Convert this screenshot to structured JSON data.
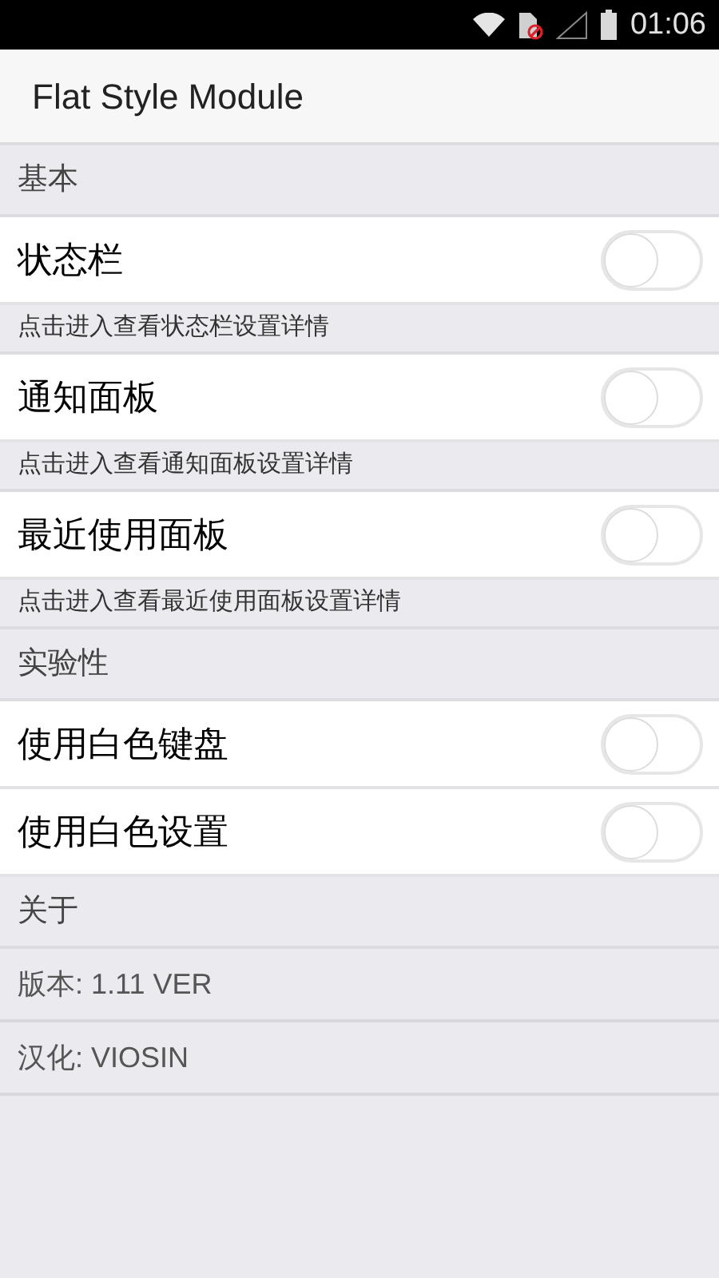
{
  "status_bar": {
    "time": "01:06"
  },
  "app_bar": {
    "title": "Flat Style Module"
  },
  "sections": [
    {
      "header": "基本",
      "items": [
        {
          "kind": "toggle",
          "label": "状态栏",
          "on": false
        },
        {
          "kind": "hint",
          "text": "点击进入查看状态栏设置详情"
        },
        {
          "kind": "toggle",
          "label": "通知面板",
          "on": false
        },
        {
          "kind": "hint",
          "text": "点击进入查看通知面板设置详情"
        },
        {
          "kind": "toggle",
          "label": "最近使用面板",
          "on": false
        },
        {
          "kind": "hint",
          "text": "点击进入查看最近使用面板设置详情"
        }
      ]
    },
    {
      "header": "实验性",
      "items": [
        {
          "kind": "toggle",
          "label": "使用白色键盘",
          "on": false
        },
        {
          "kind": "toggle",
          "label": "使用白色设置",
          "on": false
        }
      ]
    },
    {
      "header": "关于",
      "items": [
        {
          "kind": "info",
          "label": "版本:",
          "value": "1.11 VER"
        },
        {
          "kind": "info",
          "label": "汉化:",
          "value": "VIOSIN"
        }
      ]
    }
  ]
}
